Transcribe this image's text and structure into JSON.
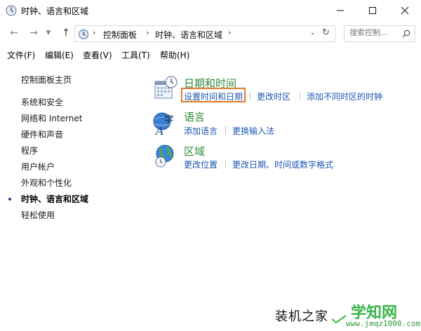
{
  "window": {
    "title": "时钟、语言和区域"
  },
  "address": {
    "breadcrumbs": [
      "控制面板",
      "时钟、语言和区域"
    ],
    "search_placeholder": "搜索控制..."
  },
  "menu": [
    "文件(F)",
    "编辑(E)",
    "查看(V)",
    "工具(T)",
    "帮助(H)"
  ],
  "sidebar": {
    "home": "控制面板主页",
    "items": [
      "系统和安全",
      "网络和 Internet",
      "硬件和声音",
      "程序",
      "用户帐户",
      "外观和个性化",
      "时钟、语言和区域",
      "轻松使用"
    ],
    "active_index": 6
  },
  "categories": [
    {
      "title": "日期和时间",
      "icon": "calendar-clock-icon",
      "links": [
        "设置时间和日期",
        "更改时区",
        "添加不同时区的时钟"
      ]
    },
    {
      "title": "语言",
      "icon": "language-icon",
      "links": [
        "添加语言",
        "更换输入法"
      ]
    },
    {
      "title": "区域",
      "icon": "globe-clock-icon",
      "links": [
        "更改位置",
        "更改日期、时间或数字格式"
      ]
    }
  ],
  "colors": {
    "category_title": "#2e8b3a",
    "link": "#1a56b5",
    "highlight_box": "#e07a2b"
  },
  "watermark": {
    "left_text": "装机之家",
    "brand": "学知网",
    "url": "www.jmqz1000.com"
  }
}
